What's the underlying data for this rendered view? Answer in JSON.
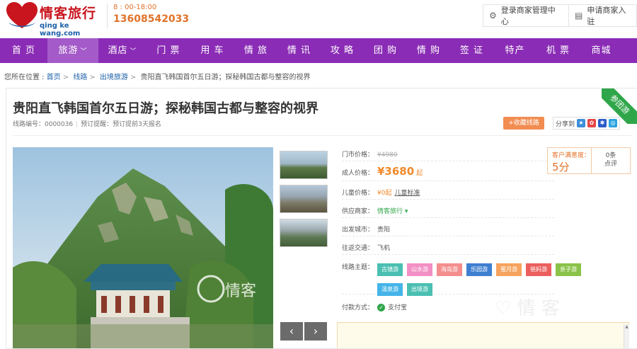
{
  "header": {
    "brand": "情客旅行",
    "site": "qing ke wang.com",
    "hours": "8 : 00-18:00",
    "phone": "13608542033",
    "login_label": "登录商家管理中心",
    "apply_label": "申请商家入驻"
  },
  "nav": {
    "items": [
      {
        "label": "首 页"
      },
      {
        "label": "旅游",
        "dropdown": true
      },
      {
        "label": "酒店",
        "dropdown": true
      },
      {
        "label": "门 票"
      },
      {
        "label": "用 车"
      },
      {
        "label": "情 旅"
      },
      {
        "label": "情 讯"
      },
      {
        "label": "攻 略"
      },
      {
        "label": "团 购"
      },
      {
        "label": "情 购"
      },
      {
        "label": "签 证"
      },
      {
        "label": "特产"
      },
      {
        "label": "机 票"
      },
      {
        "label": "商城"
      }
    ]
  },
  "breadcrumb": {
    "prefix": "您所在位置 :",
    "items": [
      "首页",
      "线路",
      "出境旅游"
    ],
    "current": "贵阳直飞韩国首尔五日游；探秘韩国古都与整容的视界"
  },
  "product": {
    "title": "贵阳直飞韩国首尔五日游；探秘韩国古都与整容的视界",
    "ribbon": "参团游",
    "code_label": "线路编号：0000036",
    "reserve_note": "预订提醒：预订提前3天报名",
    "fav_label": "+收藏线路",
    "share_label": "分享到"
  },
  "pricing": {
    "market_label": "门市价格：",
    "market_price": "¥4980",
    "adult_label": "成人价格：",
    "adult_price": "¥3680",
    "adult_suffix": "起",
    "child_label": "儿童价格：",
    "child_price": "¥0起",
    "child_standard": "儿童标准",
    "supplier_label": "供应商家：",
    "supplier": "情客旅行",
    "depart_label": "出发城市：",
    "depart": "贵阳",
    "transport_label": "往返交通：",
    "transport": "飞机",
    "theme_label": "线路主题：",
    "themes": [
      {
        "label": "古镇游",
        "color": "#4bbfb2"
      },
      {
        "label": "山水游",
        "color": "#f28fc4"
      },
      {
        "label": "海岛游",
        "color": "#f48e8e"
      },
      {
        "label": "乐园游",
        "color": "#3f7fd1"
      },
      {
        "label": "蜜月游",
        "color": "#f5a35e"
      },
      {
        "label": "爸妈游",
        "color": "#ec5f5f"
      },
      {
        "label": "亲子游",
        "color": "#8bc34a"
      },
      {
        "label": "温泉游",
        "color": "#45b4e8"
      },
      {
        "label": "出境游",
        "color": "#4bbfb2"
      }
    ],
    "pay_label": "付款方式：",
    "pay": "支付宝"
  },
  "rating": {
    "label": "客户满意度：",
    "score": "5分",
    "reviews_count": "0条",
    "reviews_label": "点评"
  },
  "colors": {
    "nav_bg": "#8a2cb5",
    "accent": "#f08a2c",
    "green": "#2fa64a"
  }
}
